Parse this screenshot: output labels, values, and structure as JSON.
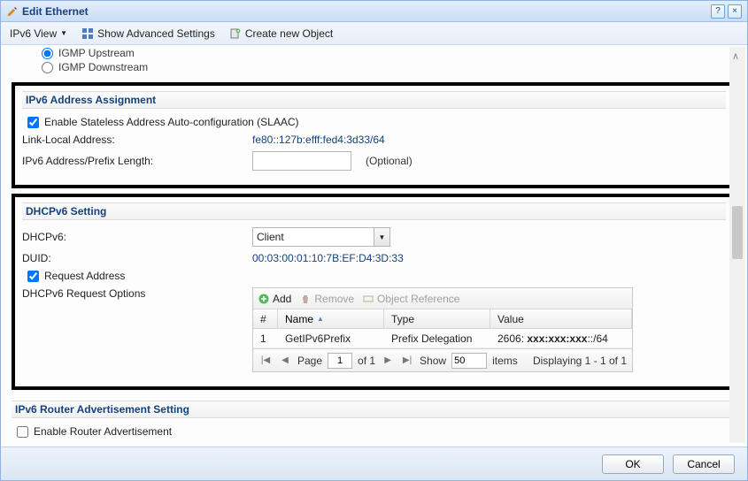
{
  "window": {
    "title": "Edit Ethernet"
  },
  "toolbar": {
    "view_label": "IPv6 View",
    "advanced_label": "Show Advanced Settings",
    "create_label": "Create new Object"
  },
  "igmp": {
    "upstream_label": "IGMP Upstream",
    "downstream_label": "IGMP Downstream"
  },
  "ipv6_assign": {
    "heading": "IPv6 Address Assignment",
    "slaac_label": "Enable Stateless Address Auto-configuration (SLAAC)",
    "linklocal_label": "Link-Local Address:",
    "linklocal_value": "fe80::127b:efff:fed4:3d33/64",
    "prefix_label": "IPv6 Address/Prefix Length:",
    "prefix_value": "",
    "optional_label": "(Optional)"
  },
  "dhcpv6": {
    "heading": "DHCPv6 Setting",
    "dhcpv6_label": "DHCPv6:",
    "dhcpv6_value": "Client",
    "duid_label": "DUID:",
    "duid_value": "00:03:00:01:10:7B:EF:D4:3D:33",
    "request_addr_label": "Request Address",
    "request_options_label": "DHCPv6 Request Options",
    "table_toolbar": {
      "add": "Add",
      "remove": "Remove",
      "objref": "Object Reference"
    },
    "table_headers": {
      "num": "#",
      "name": "Name",
      "type": "Type",
      "value": "Value"
    },
    "table_rows": [
      {
        "num": "1",
        "name": "GetIPv6Prefix",
        "type": "Prefix Delegation",
        "value_prefix": "2606: ",
        "value_mask": "xxx:xxx:xxx",
        "value_suffix": "::/64"
      }
    ],
    "pager": {
      "page_label": "Page",
      "page_value": "1",
      "of_label": "of 1",
      "show_label": "Show",
      "show_value": "50",
      "items_label": "items",
      "display_label": "Displaying 1 - 1 of 1"
    }
  },
  "ra": {
    "heading": "IPv6 Router Advertisement Setting",
    "enable_label": "Enable Router Advertisement"
  },
  "buttons": {
    "ok": "OK",
    "cancel": "Cancel"
  }
}
